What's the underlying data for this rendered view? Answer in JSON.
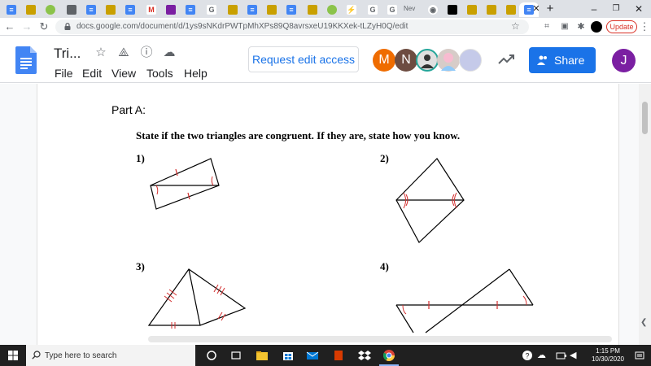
{
  "browser": {
    "new_tab_label": "Nev",
    "url": "docs.google.com/document/d/1ys9sNKdrPWTpMhXPs89Q8avrsxeU19KKXek-tLZyH0Q/edit",
    "update_label": "Update"
  },
  "docs": {
    "title": "Tri...",
    "menus": [
      "File",
      "Edit",
      "View",
      "Tools",
      "Help"
    ],
    "request_edit_label": "Request edit access",
    "share_label": "Share",
    "user_initial": "J",
    "collaborators": [
      {
        "initial": "M",
        "color": "#ef6c00"
      },
      {
        "initial": "N",
        "color": "#6d4c41"
      },
      {
        "initial": "",
        "color": "#c5cae9"
      }
    ]
  },
  "document": {
    "part_label": "Part A:",
    "instruction": "State if the two triangles are congruent.  If they are, state how you know.",
    "problems": [
      "1)",
      "2)",
      "3)",
      "4)"
    ]
  },
  "taskbar": {
    "search_placeholder": "Type here to search",
    "time": "1:15 PM",
    "date": "10/30/2020"
  },
  "colors": {
    "brand_blue": "#1a73e8",
    "mark_red": "#d32f2f",
    "update_red": "#d93025"
  }
}
